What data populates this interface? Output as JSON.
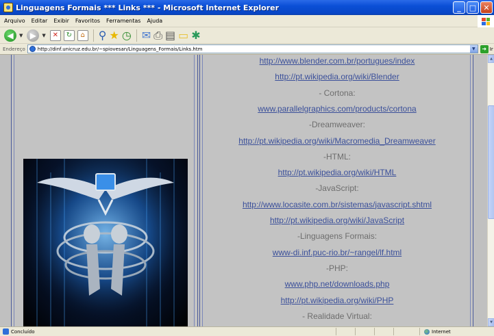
{
  "window": {
    "title": "Linguagens Formais *** Links *** - Microsoft Internet Explorer",
    "minimize_glyph": "_",
    "maximize_glyph": "□",
    "close_glyph": "✕"
  },
  "menubar": {
    "items": [
      "Arquivo",
      "Editar",
      "Exibir",
      "Favoritos",
      "Ferramentas",
      "Ajuda"
    ]
  },
  "toolbar": {
    "icons": [
      "back-icon",
      "forward-icon",
      "stop-icon",
      "refresh-icon",
      "home-icon",
      "search-icon",
      "favorites-icon",
      "history-icon",
      "mail-icon",
      "print-icon",
      "edit-icon",
      "folder-icon",
      "messenger-icon"
    ]
  },
  "addressbar": {
    "label": "Endereço",
    "url": "http://dinf.unicruz.edu.br/~spiovesan/Linguagens_Formais/Links.htm",
    "go_label": "Ir"
  },
  "page": {
    "lines": [
      {
        "type": "link",
        "text": "http://www.blender.com.br/portugues/index"
      },
      {
        "type": "link",
        "text": "http://pt.wikipedia.org/wiki/Blender"
      },
      {
        "type": "label",
        "text": "- Cortona:"
      },
      {
        "type": "link",
        "text": "www.parallelgraphics.com/products/cortona"
      },
      {
        "type": "label",
        "text": "-Dreamweaver:"
      },
      {
        "type": "link",
        "text": "http://pt.wikipedia.org/wiki/Macromedia_Dreamweaver"
      },
      {
        "type": "label",
        "text": "-HTML:"
      },
      {
        "type": "link",
        "text": "http://pt.wikipedia.org/wiki/HTML"
      },
      {
        "type": "label",
        "text": "-JavaScript:"
      },
      {
        "type": "link",
        "text": "http://www.locasite.com.br/sistemas/javascript.shtml"
      },
      {
        "type": "link",
        "text": "http://pt.wikipedia.org/wiki/JavaScript"
      },
      {
        "type": "label",
        "text": "-Linguagens Formais:"
      },
      {
        "type": "link",
        "text": "www-di.inf.puc-rio.br/~rangel/lf.html"
      },
      {
        "type": "label",
        "text": "-PHP:"
      },
      {
        "type": "link",
        "text": "www.php.net/downloads.php"
      },
      {
        "type": "link",
        "text": "http://pt.wikipedia.org/wiki/PHP"
      },
      {
        "type": "label",
        "text": "- Realidade Virtual:"
      }
    ]
  },
  "statusbar": {
    "status_text": "Concluído",
    "zone_text": "Internet"
  },
  "colors": {
    "link": "#3a4f9a",
    "label": "#6d6d6d",
    "page_bg": "#c3c3c3",
    "titlebar": "#0a4fd6"
  }
}
